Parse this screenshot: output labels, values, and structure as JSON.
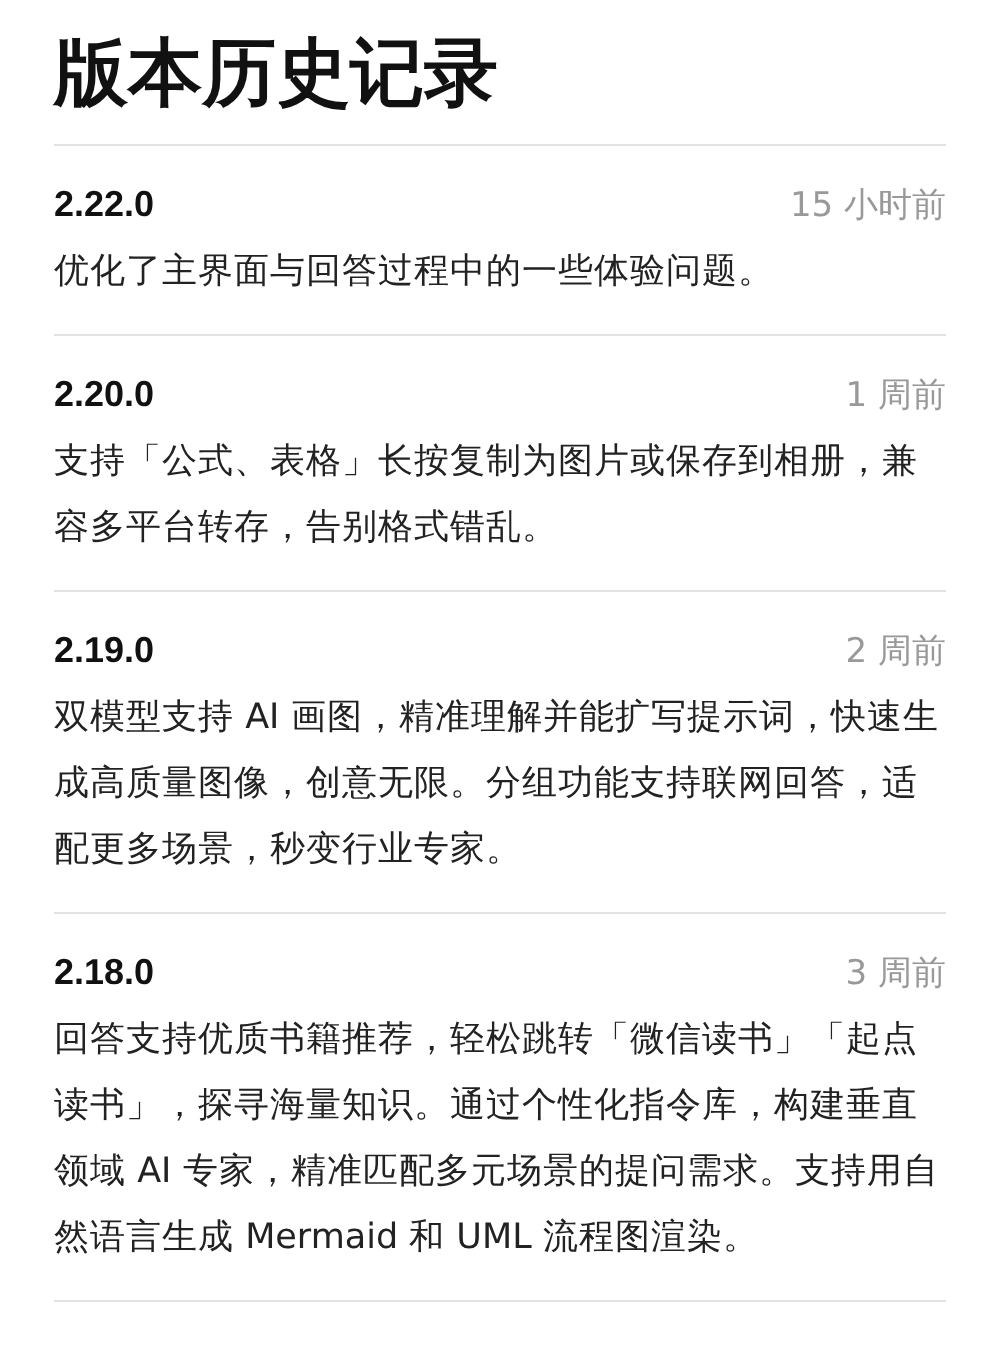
{
  "title": "版本历史记录",
  "releases": [
    {
      "version": "2.22.0",
      "time": "15 小时前",
      "notes": "优化了主界面与回答过程中的一些体验问题。"
    },
    {
      "version": "2.20.0",
      "time": "1 周前",
      "notes": "支持「公式、表格」长按复制为图片或保存到相册，兼容多平台转存，告别格式错乱。"
    },
    {
      "version": "2.19.0",
      "time": "2 周前",
      "notes": "双模型支持 AI 画图，精准理解并能扩写提示词，快速生成高质量图像，创意无限。分组功能支持联网回答，适配更多场景，秒变行业专家。"
    },
    {
      "version": "2.18.0",
      "time": "3 周前",
      "notes": "回答支持优质书籍推荐，轻松跳转「微信读书」「起点读书」，探寻海量知识。通过个性化指令库，构建垂直领域 AI 专家，精准匹配多元场景的提问需求。支持用自然语言生成 Mermaid 和 UML 流程图渲染。"
    }
  ]
}
